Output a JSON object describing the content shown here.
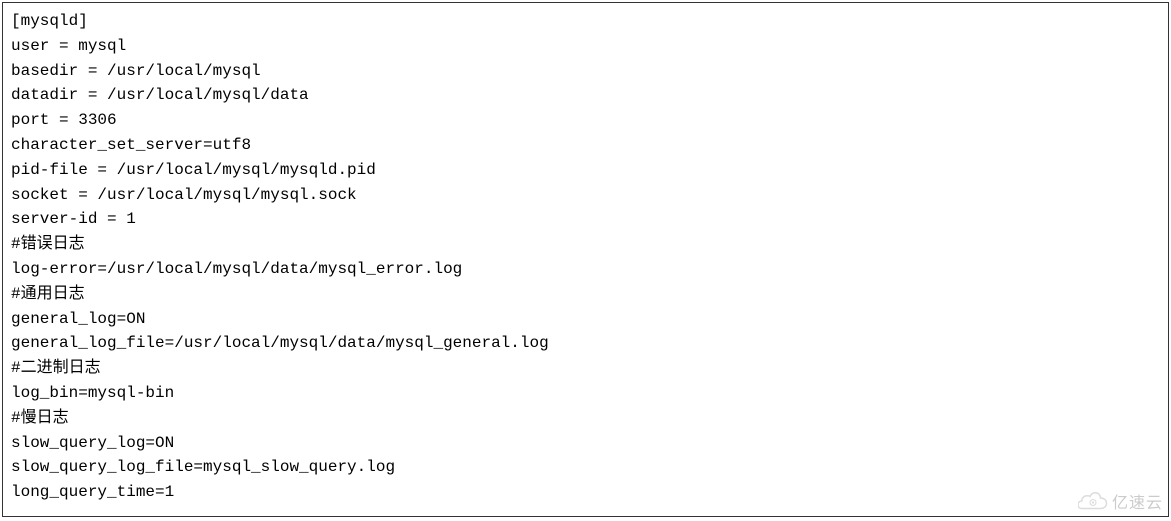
{
  "config": {
    "lines": [
      "[mysqld]",
      "user = mysql",
      "basedir = /usr/local/mysql",
      "datadir = /usr/local/mysql/data",
      "port = 3306",
      "character_set_server=utf8",
      "pid-file = /usr/local/mysql/mysqld.pid",
      "socket = /usr/local/mysql/mysql.sock",
      "server-id = 1",
      "#错误日志",
      "log-error=/usr/local/mysql/data/mysql_error.log",
      "#通用日志",
      "general_log=ON",
      "general_log_file=/usr/local/mysql/data/mysql_general.log",
      "#二进制日志",
      "log_bin=mysql-bin",
      "#慢日志",
      "slow_query_log=ON",
      "slow_query_log_file=mysql_slow_query.log",
      "long_query_time=1"
    ]
  },
  "watermark": {
    "text": "亿速云"
  }
}
